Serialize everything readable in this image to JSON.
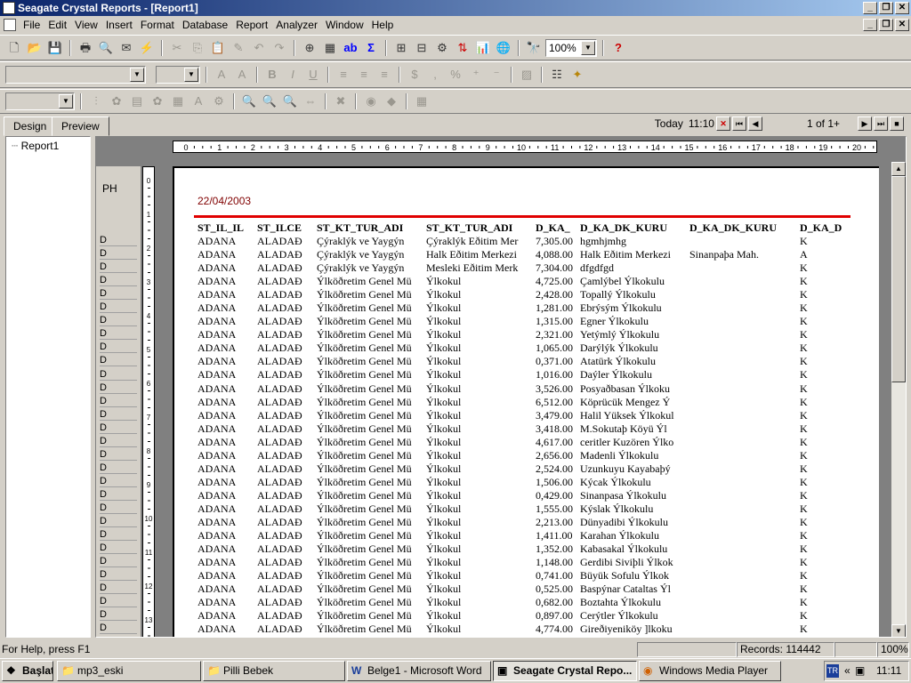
{
  "app": {
    "title": "Seagate Crystal Reports - [Report1]"
  },
  "menu": [
    "File",
    "Edit",
    "View",
    "Insert",
    "Format",
    "Database",
    "Report",
    "Analyzer",
    "Window",
    "Help"
  ],
  "toolbar": {
    "zoom": "100%"
  },
  "tabs": {
    "design": "Design",
    "preview": "Preview"
  },
  "nav": {
    "today": "Today",
    "time": "11:10",
    "page": "1 of 1+"
  },
  "tree": {
    "root": "Report1"
  },
  "sections": {
    "page_header": "PH",
    "detail": "D"
  },
  "report": {
    "date": "22/04/2003",
    "columns": [
      "ST_IL_IL",
      "ST_ILCE",
      "ST_KT_TUR_ADI",
      "ST_KT_TUR_ADI",
      "D_KA_",
      "D_KA_DK_KURU",
      "D_KA_DK_KURU",
      "D_KA_D"
    ],
    "rows": [
      [
        "ADANA",
        "ALADAĐ",
        "Çýraklýk ve Yaygýn",
        "Çýraklýk Eðitim Mer",
        "7,305.00",
        "hgmhjmhg",
        "",
        "K"
      ],
      [
        "ADANA",
        "ALADAĐ",
        "Çýraklýk ve Yaygýn",
        "Halk Eðitim Merkezi",
        "4,088.00",
        "Halk Eðitim Merkezi",
        "Sinanpaþa Mah.",
        "A"
      ],
      [
        "ADANA",
        "ALADAĐ",
        "Çýraklýk ve Yaygýn",
        "Mesleki Eðitim Merk",
        "7,304.00",
        "dfgdfgd",
        "",
        "K"
      ],
      [
        "ADANA",
        "ALADAĐ",
        "Ýlköðretim Genel Mü",
        "Ýlkokul",
        "4,725.00",
        "Çamlýbel Ýlkokulu",
        "",
        "K"
      ],
      [
        "ADANA",
        "ALADAĐ",
        "Ýlköðretim Genel Mü",
        "Ýlkokul",
        "2,428.00",
        "Topallý Ýlkokulu",
        "",
        "K"
      ],
      [
        "ADANA",
        "ALADAĐ",
        "Ýlköðretim Genel Mü",
        "Ýlkokul",
        "1,281.00",
        "Ebrýsým Ýlkokulu",
        "",
        "K"
      ],
      [
        "ADANA",
        "ALADAĐ",
        "Ýlköðretim Genel Mü",
        "Ýlkokul",
        "1,315.00",
        "Egner Ýlkokulu",
        "",
        "K"
      ],
      [
        "ADANA",
        "ALADAĐ",
        "Ýlköðretim Genel Mü",
        "Ýlkokul",
        "2,321.00",
        "Yetýmlý Ýlkokulu",
        "",
        "K"
      ],
      [
        "ADANA",
        "ALADAĐ",
        "Ýlköðretim Genel Mü",
        "Ýlkokul",
        "1,065.00",
        "Darýlýk Ýlkokulu",
        "",
        "K"
      ],
      [
        "ADANA",
        "ALADAĐ",
        "Ýlköðretim Genel Mü",
        "Ýlkokul",
        "0,371.00",
        "Atatürk Ýlkokulu",
        "",
        "K"
      ],
      [
        "ADANA",
        "ALADAĐ",
        "Ýlköðretim Genel Mü",
        "Ýlkokul",
        "1,016.00",
        "Daýler Ýlkokulu",
        "",
        "K"
      ],
      [
        "ADANA",
        "ALADAĐ",
        "Ýlköðretim Genel Mü",
        "Ýlkokul",
        "3,526.00",
        "Posyaðbasan Ýlkoku",
        "",
        "K"
      ],
      [
        "ADANA",
        "ALADAĐ",
        "Ýlköðretim Genel Mü",
        "Ýlkokul",
        "6,512.00",
        "Köprücük Mengez Ý",
        "",
        "K"
      ],
      [
        "ADANA",
        "ALADAĐ",
        "Ýlköðretim Genel Mü",
        "Ýlkokul",
        "3,479.00",
        "Halil Yüksek Ýlkokul",
        "",
        "K"
      ],
      [
        "ADANA",
        "ALADAĐ",
        "Ýlköðretim Genel Mü",
        "Ýlkokul",
        "3,418.00",
        "M.Sokutaþ Köyü Ýl",
        "",
        "K"
      ],
      [
        "ADANA",
        "ALADAĐ",
        "Ýlköðretim Genel Mü",
        "Ýlkokul",
        "4,617.00",
        "ceritler Kuzören Ýlko",
        "",
        "K"
      ],
      [
        "ADANA",
        "ALADAĐ",
        "Ýlköðretim Genel Mü",
        "Ýlkokul",
        "2,656.00",
        "Madenli Ýlkokulu",
        "",
        "K"
      ],
      [
        "ADANA",
        "ALADAĐ",
        "Ýlköðretim Genel Mü",
        "Ýlkokul",
        "2,524.00",
        "Uzunkuyu Kayabaþý",
        "",
        "K"
      ],
      [
        "ADANA",
        "ALADAĐ",
        "Ýlköðretim Genel Mü",
        "Ýlkokul",
        "1,506.00",
        "Kýcak Ýlkokulu",
        "",
        "K"
      ],
      [
        "ADANA",
        "ALADAĐ",
        "Ýlköðretim Genel Mü",
        "Ýlkokul",
        "0,429.00",
        "Sinanpasa Ýlkokulu",
        "",
        "K"
      ],
      [
        "ADANA",
        "ALADAĐ",
        "Ýlköðretim Genel Mü",
        "Ýlkokul",
        "1,555.00",
        "Kýslak Ýlkokulu",
        "",
        "K"
      ],
      [
        "ADANA",
        "ALADAĐ",
        "Ýlköðretim Genel Mü",
        "Ýlkokul",
        "2,213.00",
        "Dünyadibi Ýlkokulu",
        "",
        "K"
      ],
      [
        "ADANA",
        "ALADAĐ",
        "Ýlköðretim Genel Mü",
        "Ýlkokul",
        "1,411.00",
        "Karahan Ýlkokulu",
        "",
        "K"
      ],
      [
        "ADANA",
        "ALADAĐ",
        "Ýlköðretim Genel Mü",
        "Ýlkokul",
        "1,352.00",
        "Kabasakal Ýlkokulu",
        "",
        "K"
      ],
      [
        "ADANA",
        "ALADAĐ",
        "Ýlköðretim Genel Mü",
        "Ýlkokul",
        "1,148.00",
        "Gerdibi Siviþli Ýlkok",
        "",
        "K"
      ],
      [
        "ADANA",
        "ALADAĐ",
        "Ýlköðretim Genel Mü",
        "Ýlkokul",
        "0,741.00",
        "Büyük Sofulu Ýlkok",
        "",
        "K"
      ],
      [
        "ADANA",
        "ALADAĐ",
        "Ýlköðretim Genel Mü",
        "Ýlkokul",
        "0,525.00",
        "Baspýnar Cataltas Ýl",
        "",
        "K"
      ],
      [
        "ADANA",
        "ALADAĐ",
        "Ýlköðretim Genel Mü",
        "Ýlkokul",
        "0,682.00",
        "Boztahta Ýlkokulu",
        "",
        "K"
      ],
      [
        "ADANA",
        "ALADAĐ",
        "Ýlköðretim Genel Mü",
        "Ýlkokul",
        "0,897.00",
        "Cerýtler Ýlkokulu",
        "",
        "K"
      ],
      [
        "ADANA",
        "ALADAĐ",
        "Ýlköðretim Genel Mü",
        "Ýlkokul",
        "4,774.00",
        "Gireðiyeniköy ]lkoku",
        "",
        "K"
      ]
    ]
  },
  "status": {
    "help": "For Help, press F1",
    "records": "Records: 114442",
    "zoom": "100%"
  },
  "taskbar": {
    "start": "Başlat",
    "tasks": [
      "mp3_eski",
      "Pilli Bebek",
      "Belge1 - Microsoft Word",
      "Seagate Crystal Repo...",
      "Windows Media Player"
    ],
    "lang": "TR",
    "clock": "11:11"
  }
}
